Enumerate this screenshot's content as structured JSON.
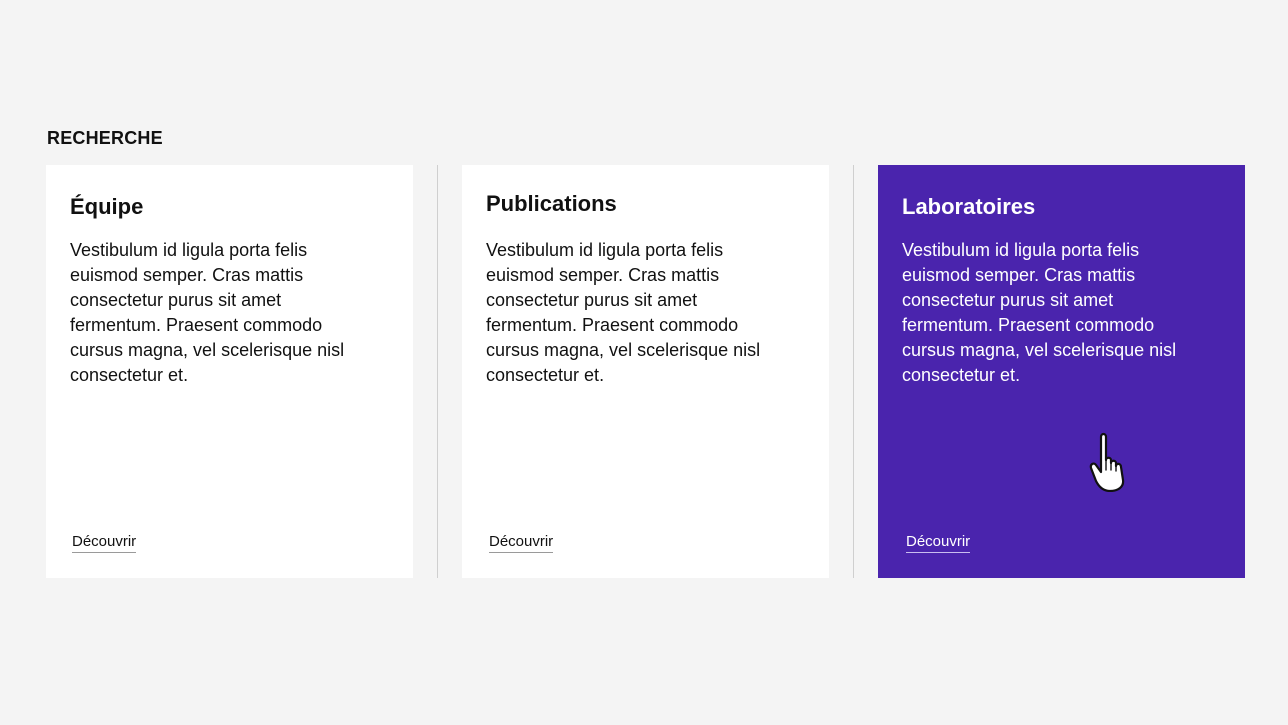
{
  "section": {
    "title": "RECHERCHE"
  },
  "cards": [
    {
      "title": "Équipe",
      "body": "Vestibulum id ligula porta felis euismod semper. Cras mattis consectetur purus sit amet fermentum. Praesent commodo cursus magna, vel scelerisque nisl consectetur et.",
      "link": "Découvrir"
    },
    {
      "title": "Publications",
      "body": "Vestibulum id ligula porta felis euismod semper. Cras mattis consectetur purus sit amet fermentum. Praesent commodo cursus magna, vel scelerisque nisl consectetur et.",
      "link": "Découvrir"
    },
    {
      "title": "Laboratoires",
      "body": "Vestibulum id ligula porta felis euismod semper. Cras mattis consectetur purus sit amet fermentum. Praesent commodo cursus magna, vel scelerisque nisl consectetur et.",
      "link": "Découvrir",
      "state": "hover"
    }
  ],
  "colors": {
    "background": "#f4f4f4",
    "card": "#ffffff",
    "accent": "#4a24ad",
    "text": "#111111"
  },
  "cursor": {
    "icon": "hand-pointer-icon"
  }
}
